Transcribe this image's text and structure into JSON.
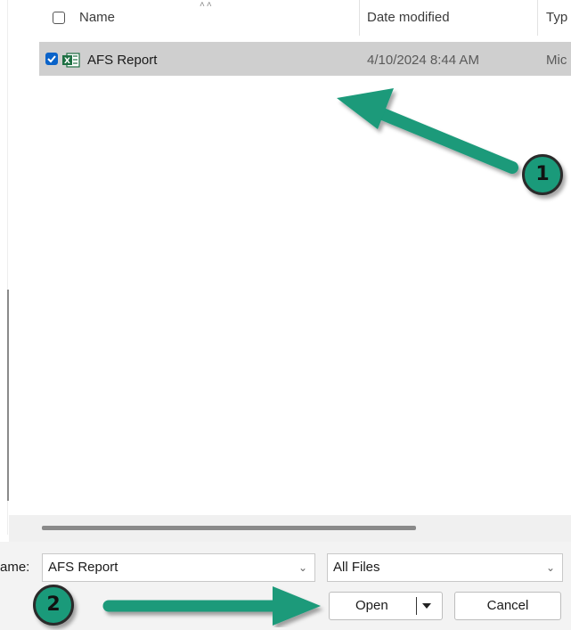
{
  "file_list": {
    "columns": {
      "name": "Name",
      "date_modified": "Date modified",
      "type": "Typ"
    },
    "rows": [
      {
        "name": "AFS Report",
        "date_modified": "4/10/2024 8:44 AM",
        "type": "Mic",
        "selected": true,
        "icon": "excel-file-icon"
      }
    ]
  },
  "footer": {
    "file_name_label": "ame:",
    "file_name_value": "AFS Report",
    "file_type_value": "All Files",
    "open_label": "Open",
    "cancel_label": "Cancel"
  },
  "annotations": {
    "badge1": "1",
    "badge2": "2",
    "color": "#1a9a7a"
  }
}
